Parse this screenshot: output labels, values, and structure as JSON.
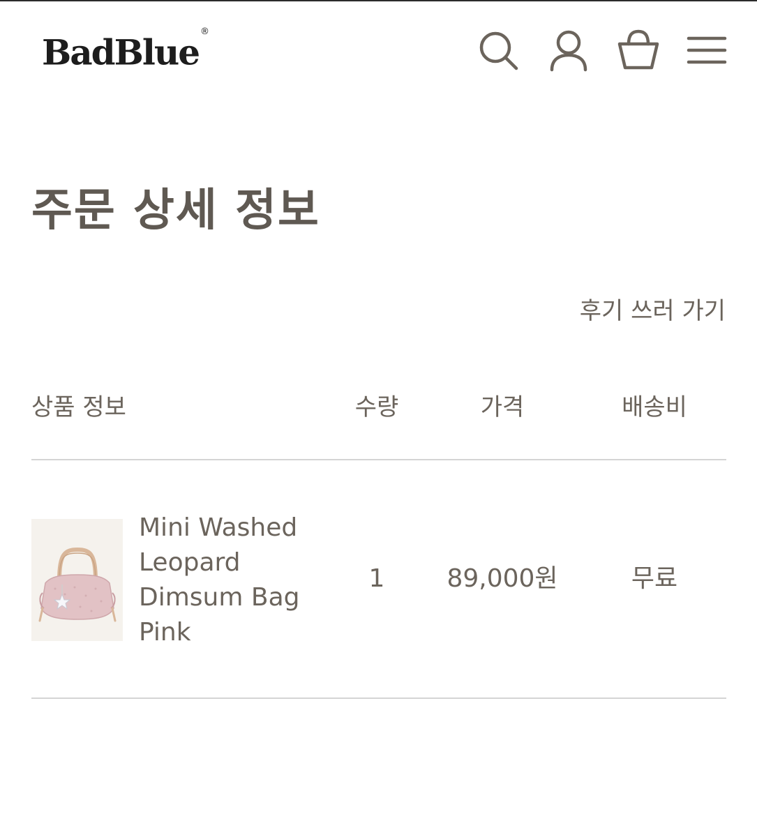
{
  "header": {
    "logo_text": "BadBlue",
    "logo_mark": "®",
    "icons": [
      "search-icon",
      "user-icon",
      "cart-icon",
      "menu-icon"
    ]
  },
  "page_title": "주문 상세 정보",
  "review_link_label": "후기 쓰러 가기",
  "table": {
    "headers": {
      "product": "상품 정보",
      "quantity": "수량",
      "price": "가격",
      "shipping": "배송비"
    },
    "rows": [
      {
        "product_name": "Mini Washed Leopard Dimsum Bag Pink",
        "quantity": "1",
        "price": "89,000원",
        "shipping": "무료"
      }
    ]
  },
  "colors": {
    "text": "#6b645c",
    "logo": "#1d1d1d",
    "divider": "#d4d4d4"
  }
}
